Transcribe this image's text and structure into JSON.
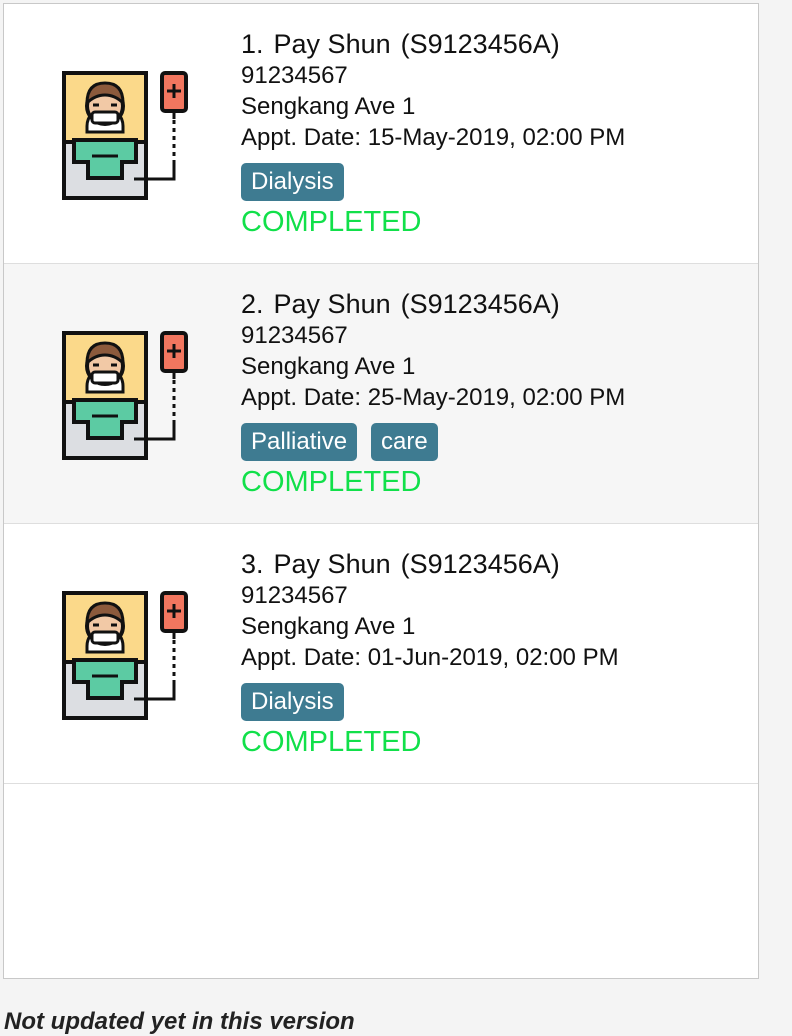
{
  "appointments": [
    {
      "index": "1.",
      "name": "Pay Shun",
      "nric": "(S9123456A)",
      "phone": "91234567",
      "address": "Sengkang Ave 1",
      "date_label": "Appt. Date: 15-May-2019, 02:00 PM",
      "tags": [
        "Dialysis"
      ],
      "status": "COMPLETED",
      "icon": "patient-iv-drip-icon"
    },
    {
      "index": "2.",
      "name": "Pay Shun",
      "nric": "(S9123456A)",
      "phone": "91234567",
      "address": "Sengkang Ave 1",
      "date_label": "Appt. Date: 25-May-2019, 02:00 PM",
      "tags": [
        "Palliative",
        "care"
      ],
      "status": "COMPLETED",
      "icon": "patient-iv-drip-icon"
    },
    {
      "index": "3.",
      "name": "Pay Shun",
      "nric": "(S9123456A)",
      "phone": "91234567",
      "address": "Sengkang Ave 1",
      "date_label": "Appt. Date: 01-Jun-2019, 02:00 PM",
      "tags": [
        "Dialysis"
      ],
      "status": "COMPLETED",
      "icon": "patient-iv-drip-icon"
    }
  ],
  "footer_note": "Not updated yet in this version",
  "colors": {
    "tag_background": "#3e7b91",
    "status_completed": "#11e04a",
    "panel_border": "#c8c8c8"
  }
}
